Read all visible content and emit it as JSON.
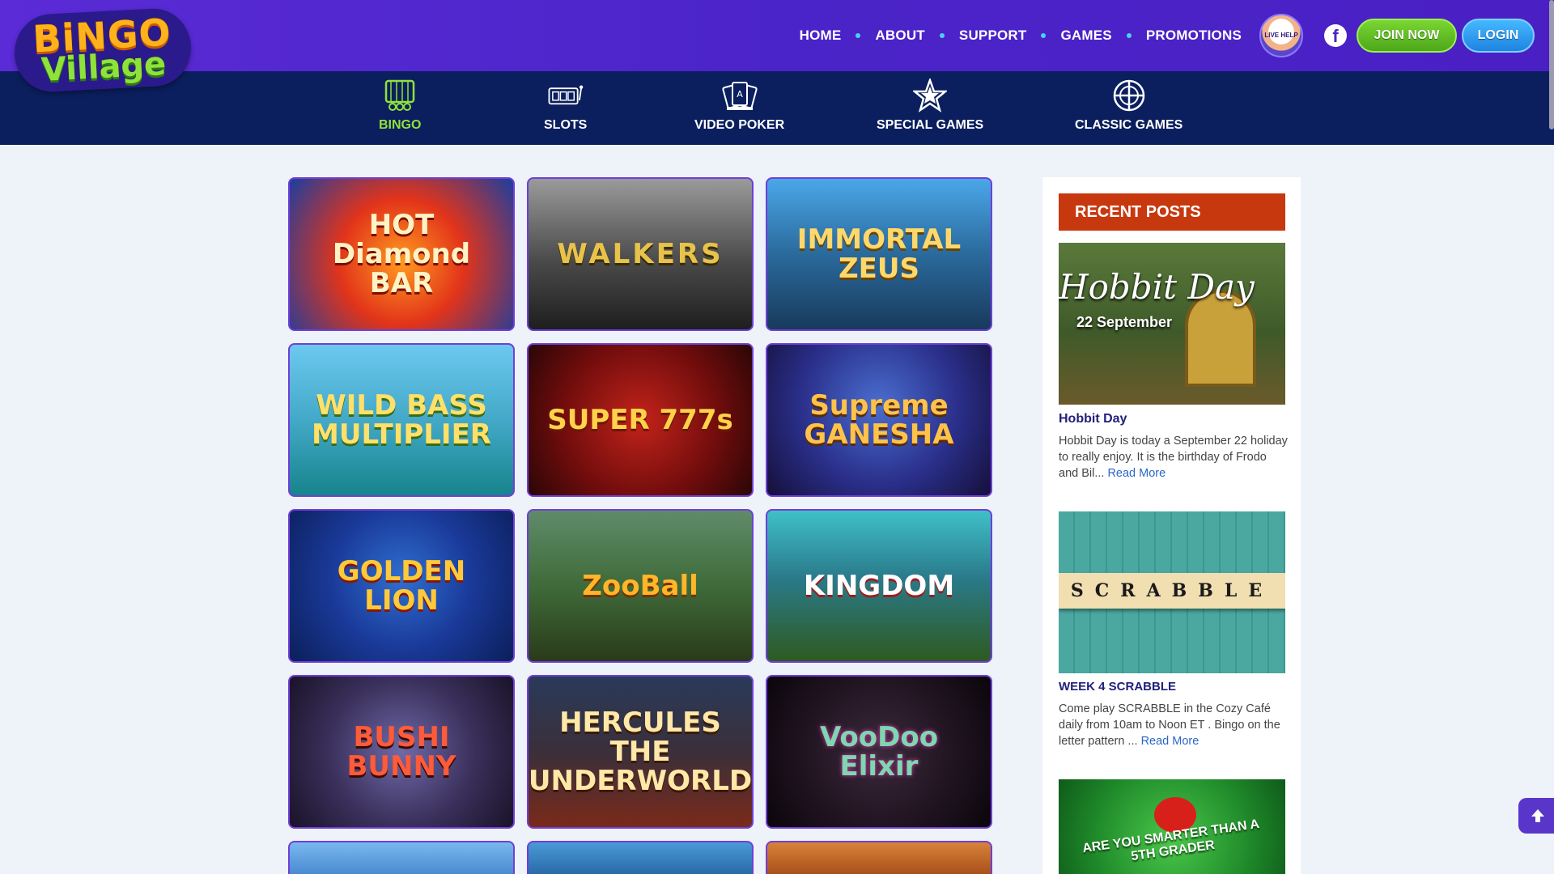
{
  "header": {
    "logo_top": "BiNGO",
    "logo_bottom": "Village",
    "nav": [
      "HOME",
      "ABOUT",
      "SUPPORT",
      "GAMES",
      "PROMOTIONS"
    ],
    "live_help": "LIVE HELP",
    "join_label": "JOIN NOW",
    "login_label": "LOGIN"
  },
  "categories": [
    {
      "label": "BINGO",
      "icon": "bingo-cage-icon",
      "active": true
    },
    {
      "label": "SLOTS",
      "icon": "slot-machine-icon",
      "active": false
    },
    {
      "label": "VIDEO POKER",
      "icon": "playing-cards-icon",
      "active": false
    },
    {
      "label": "SPECIAL GAMES",
      "icon": "star-icon",
      "active": false
    },
    {
      "label": "CLASSIC GAMES",
      "icon": "compass-icon",
      "active": false
    }
  ],
  "games": [
    {
      "title": "HOT Diamond BAR"
    },
    {
      "title": "WALKERS"
    },
    {
      "title": "IMMORTAL ZEUS"
    },
    {
      "title": "WILD BASS MULTIPLIER"
    },
    {
      "title": "SUPER 777s"
    },
    {
      "title": "Supreme GANESHA"
    },
    {
      "title": "GOLDEN LION"
    },
    {
      "title": "ZooBall"
    },
    {
      "title": "KINGDOM"
    },
    {
      "title": "BUSHI BUNNY"
    },
    {
      "title": "HERCULES THE UNDERWORLD"
    },
    {
      "title": "VooDoo Elixir"
    }
  ],
  "sidebar": {
    "heading": "RECENT POSTS",
    "posts": [
      {
        "image_title": "Hobbit Day",
        "image_subtitle": "22 September",
        "title": "Hobbit Day",
        "excerpt": "Hobbit Day is today a September 22 holiday to really enjoy. It is the birthday of Frodo and Bil... ",
        "read_more": "Read More"
      },
      {
        "image_title": "SCRABBLE",
        "title": "WEEK 4 SCRABBLE",
        "excerpt": "Come play SCRABBLE in the Cozy Café daily from 10am to Noon ET . Bingo on the letter pattern ... ",
        "read_more": "Read More"
      },
      {
        "image_title": "ARE YOU SMARTER THAN A 5TH GRADER"
      }
    ]
  },
  "colors": {
    "header": "#4b24c9",
    "category_bar": "#0b1f5e",
    "active_category": "#8fe23a",
    "recent_posts_header": "#c8380f",
    "join_button": "#5cb922",
    "login_button": "#2b95ec"
  }
}
